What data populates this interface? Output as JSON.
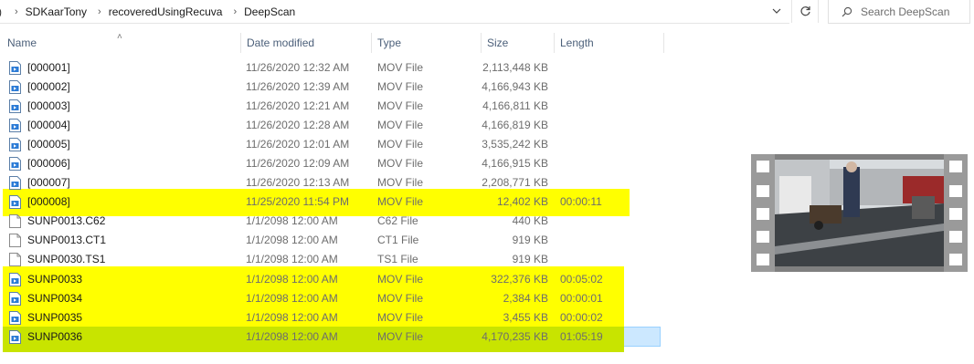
{
  "breadcrumb": {
    "items": [
      "SDKaarTony",
      "recoveredUsingRecuva",
      "DeepScan"
    ]
  },
  "search": {
    "placeholder": "Search DeepScan"
  },
  "icons": {
    "chevron": "chevron-right-icon",
    "dropdown": "chevron-down-icon",
    "refresh": "refresh-icon",
    "search": "search-icon",
    "video_file": "video-file-icon",
    "generic_file": "file-icon"
  },
  "columns": {
    "name": "Name",
    "date": "Date modified",
    "type": "Type",
    "size": "Size",
    "length": "Length"
  },
  "files": [
    {
      "name": "[000001]",
      "date": "11/26/2020 12:32 AM",
      "type": "MOV File",
      "size": "2,113,448 KB",
      "length": "",
      "icon": "video"
    },
    {
      "name": "[000002]",
      "date": "11/26/2020 12:39 AM",
      "type": "MOV File",
      "size": "4,166,943 KB",
      "length": "",
      "icon": "video"
    },
    {
      "name": "[000003]",
      "date": "11/26/2020 12:21 AM",
      "type": "MOV File",
      "size": "4,166,811 KB",
      "length": "",
      "icon": "video"
    },
    {
      "name": "[000004]",
      "date": "11/26/2020 12:28 AM",
      "type": "MOV File",
      "size": "4,166,819 KB",
      "length": "",
      "icon": "video"
    },
    {
      "name": "[000005]",
      "date": "11/26/2020 12:01 AM",
      "type": "MOV File",
      "size": "3,535,242 KB",
      "length": "",
      "icon": "video"
    },
    {
      "name": "[000006]",
      "date": "11/26/2020 12:09 AM",
      "type": "MOV File",
      "size": "4,166,915 KB",
      "length": "",
      "icon": "video"
    },
    {
      "name": "[000007]",
      "date": "11/26/2020 12:13 AM",
      "type": "MOV File",
      "size": "2,208,771 KB",
      "length": "",
      "icon": "video"
    },
    {
      "name": "[000008]",
      "date": "11/25/2020 11:54 PM",
      "type": "MOV File",
      "size": "12,402 KB",
      "length": "00:00:11",
      "icon": "video"
    },
    {
      "name": "SUNP0013.C62",
      "date": "1/1/2098 12:00 AM",
      "type": "C62 File",
      "size": "440 KB",
      "length": "",
      "icon": "file"
    },
    {
      "name": "SUNP0013.CT1",
      "date": "1/1/2098 12:00 AM",
      "type": "CT1 File",
      "size": "919 KB",
      "length": "",
      "icon": "file"
    },
    {
      "name": "SUNP0030.TS1",
      "date": "1/1/2098 12:00 AM",
      "type": "TS1 File",
      "size": "919 KB",
      "length": "",
      "icon": "file"
    },
    {
      "name": "SUNP0033",
      "date": "1/1/2098 12:00 AM",
      "type": "MOV File",
      "size": "322,376 KB",
      "length": "00:05:02",
      "icon": "video"
    },
    {
      "name": "SUNP0034",
      "date": "1/1/2098 12:00 AM",
      "type": "MOV File",
      "size": "2,384 KB",
      "length": "00:00:01",
      "icon": "video"
    },
    {
      "name": "SUNP0035",
      "date": "1/1/2098 12:00 AM",
      "type": "MOV File",
      "size": "3,455 KB",
      "length": "00:00:02",
      "icon": "video"
    },
    {
      "name": "SUNP0036",
      "date": "1/1/2098 12:00 AM",
      "type": "MOV File",
      "size": "4,170,235 KB",
      "length": "01:05:19",
      "icon": "video"
    }
  ],
  "selected_file": "SUNP0036",
  "highlighted_files": [
    "[000008]",
    "SUNP0033",
    "SUNP0034",
    "SUNP0035",
    "SUNP0036"
  ],
  "colors": {
    "highlight": "#ffff00",
    "selection": "#cce8ff",
    "header_text": "#4c607a",
    "video_icon": "#2b7bd6"
  }
}
